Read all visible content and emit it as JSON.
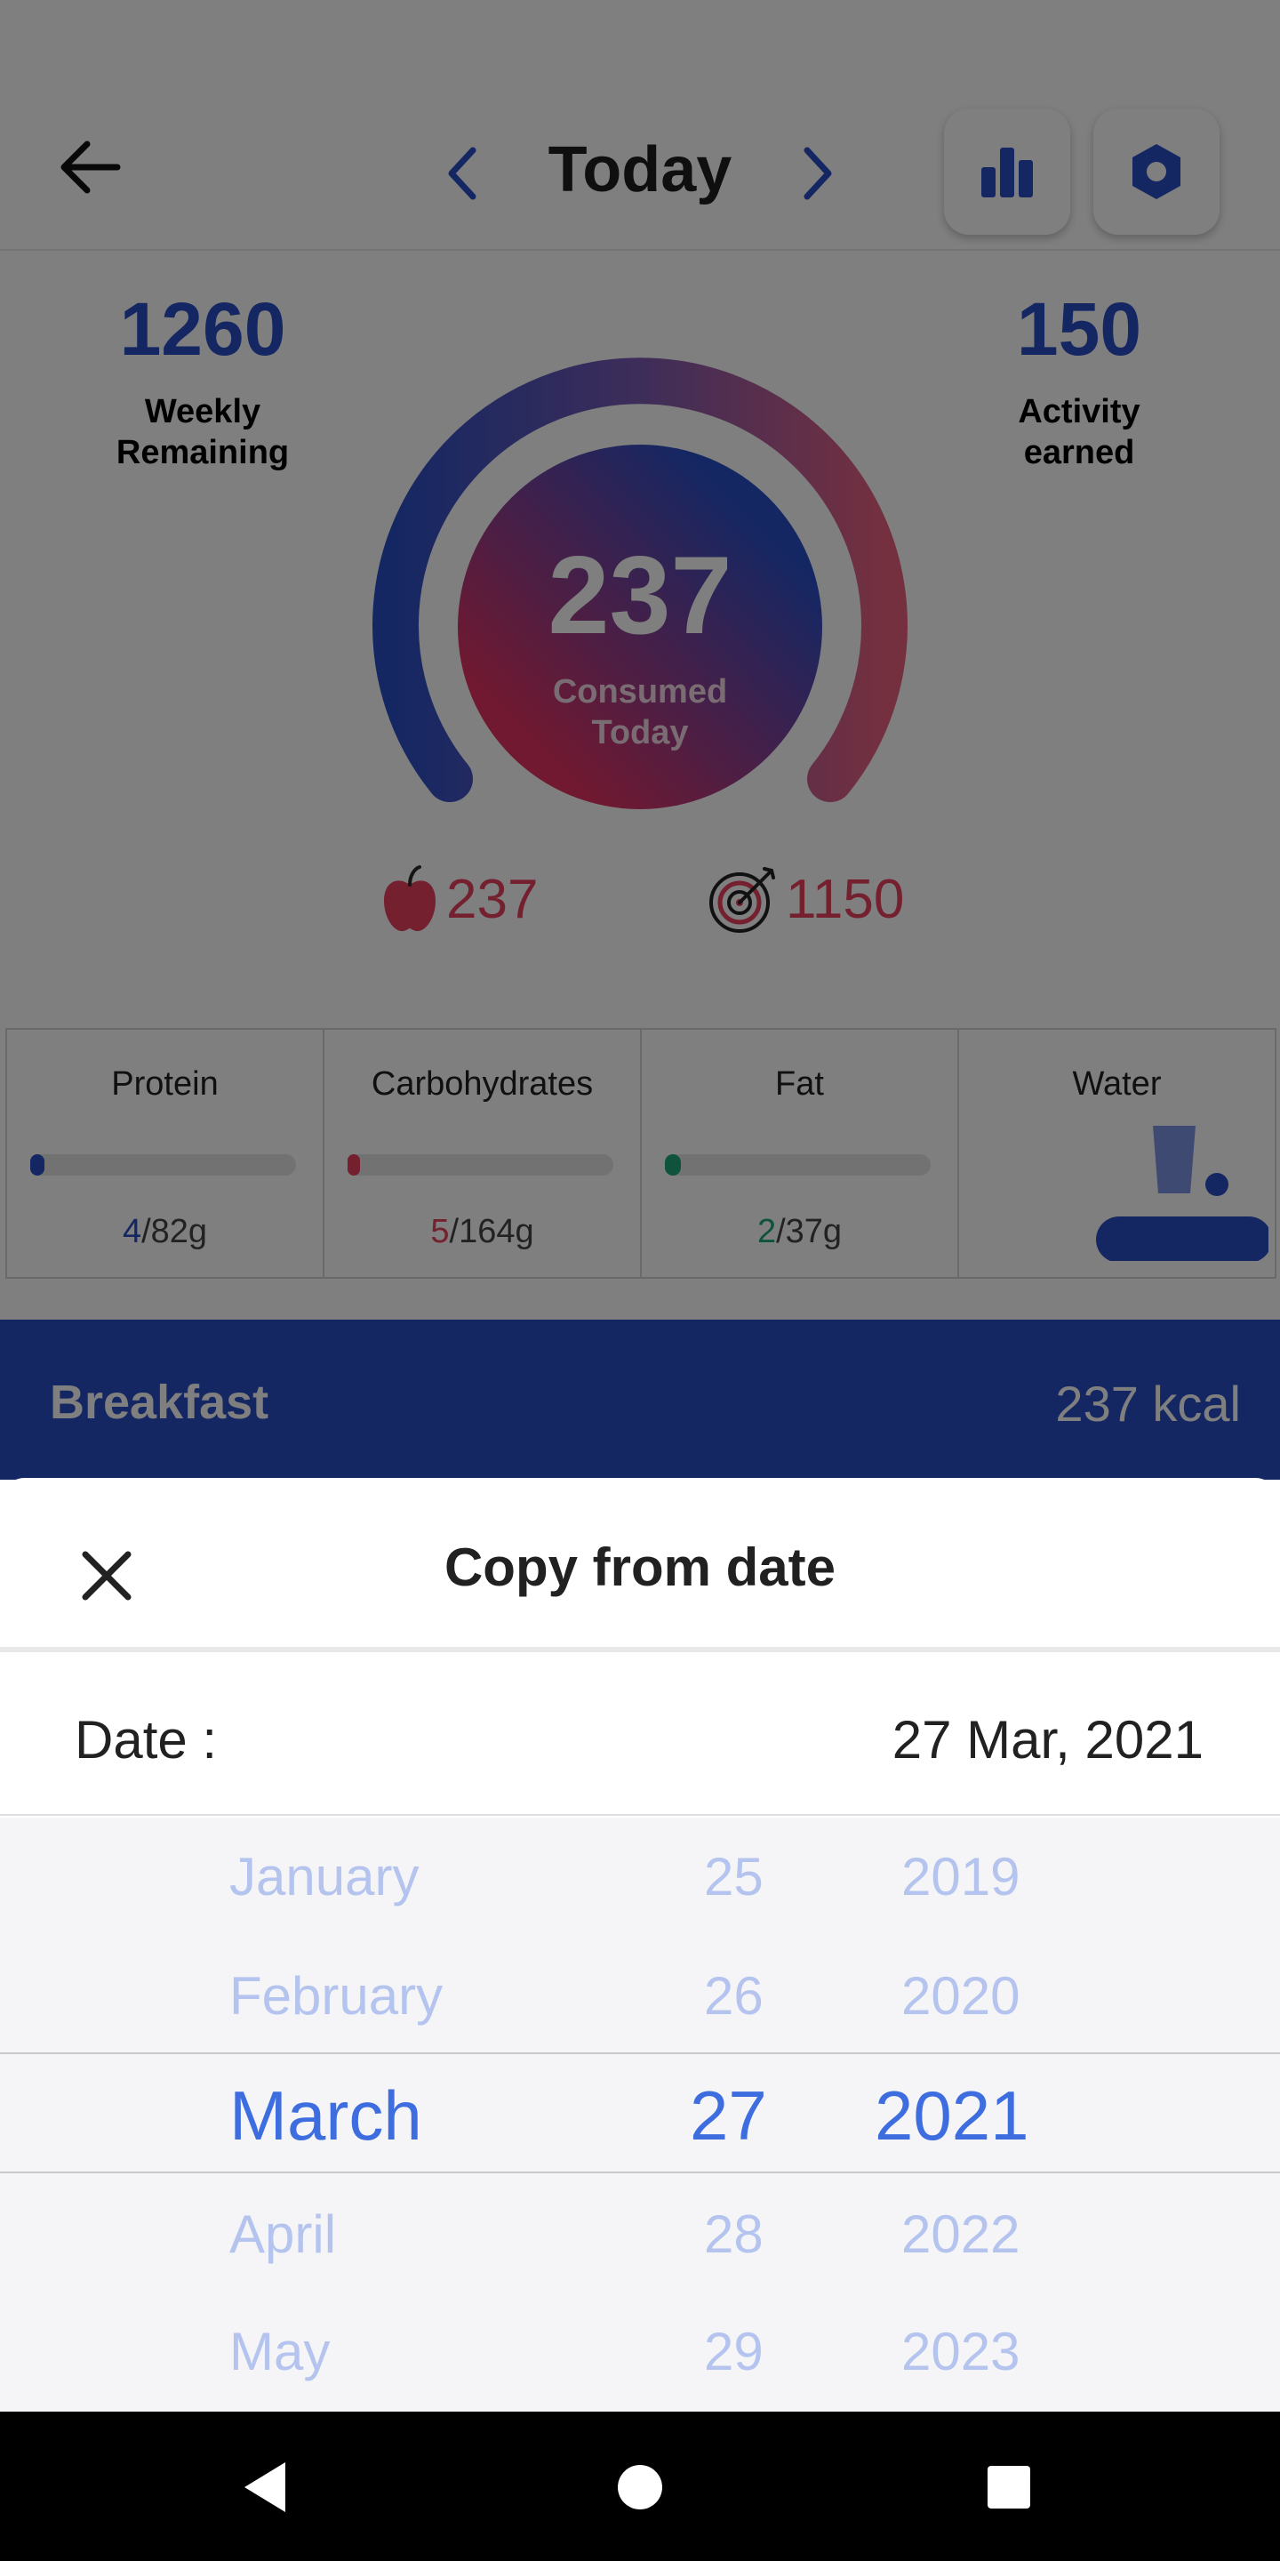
{
  "header": {
    "title": "Today",
    "back_icon": "arrow-left-icon",
    "prev_icon": "chevron-left-icon",
    "next_icon": "chevron-right-icon",
    "stats_icon": "bar-chart-icon",
    "settings_icon": "settings-hexagon-icon"
  },
  "summary": {
    "weekly_remaining_value": "1260",
    "weekly_remaining_label": "Weekly Remaining",
    "consumed_value": "237",
    "consumed_label": "Consumed Today",
    "activity_value": "150",
    "activity_label": "Activity earned",
    "food_total": "237",
    "goal_total": "1150",
    "progress_fraction": 0.206,
    "colors": {
      "blue": "#2b4fc7",
      "pink": "#e9405f"
    }
  },
  "macros": [
    {
      "name": "Protein",
      "consumed": "4",
      "goal": "/82g",
      "fraction": 0.049,
      "color": "#2b4fc7"
    },
    {
      "name": "Carbohydrates",
      "consumed": "5",
      "goal": "/164g",
      "fraction": 0.03,
      "color": "#e9405f"
    },
    {
      "name": "Fat",
      "consumed": "2",
      "goal": "/37g",
      "fraction": 0.054,
      "color": "#1fa67a"
    },
    {
      "name": "Water"
    }
  ],
  "meal": {
    "name": "Breakfast",
    "kcal": "237 kcal"
  },
  "sheet": {
    "title": "Copy from date",
    "close_icon": "close-icon",
    "date_label": "Date :",
    "date_value": "27 Mar, 2021"
  },
  "picker": {
    "months": [
      "January",
      "February",
      "March",
      "April",
      "May"
    ],
    "days": [
      "25",
      "26",
      "27",
      "28",
      "29"
    ],
    "years": [
      "2019",
      "2020",
      "2021",
      "2022",
      "2023"
    ],
    "selected_index": 2
  },
  "system_nav": {
    "back_icon": "triangle-back-icon",
    "home_icon": "circle-home-icon",
    "recents_icon": "square-recents-icon"
  }
}
